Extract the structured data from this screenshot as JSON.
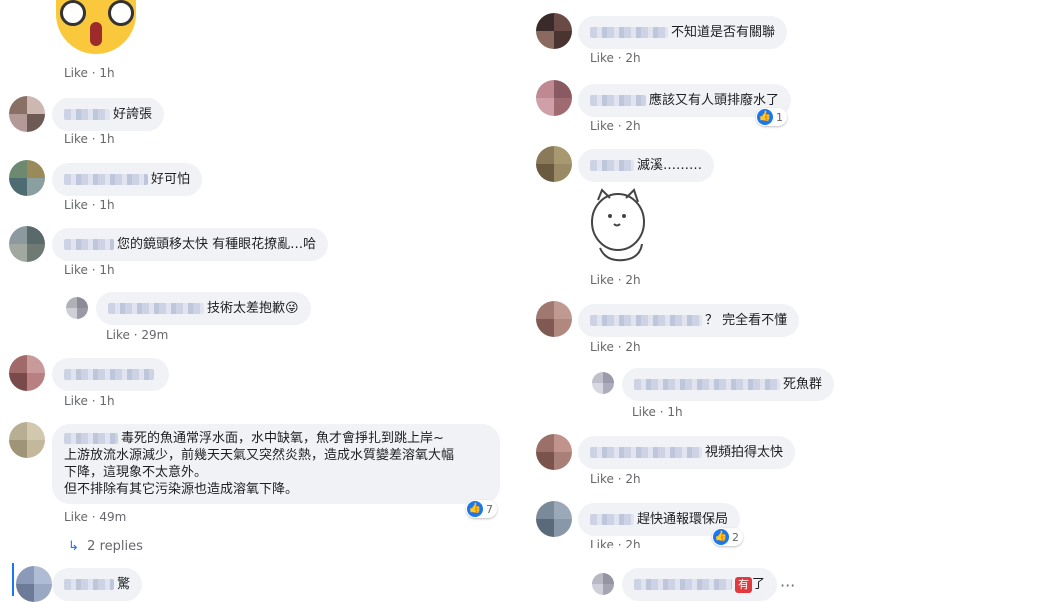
{
  "colors": {
    "bubble": "#f0f2f5",
    "meta": "#65676b",
    "like_blue": "#1877f2",
    "badge_red": "#e0393e"
  },
  "left": {
    "top_sticker": {
      "icon": "shocked-face-sticker",
      "time": "1h",
      "like": "Like"
    },
    "comments": [
      {
        "text": "好誇張",
        "like": "Like",
        "time": "1h"
      },
      {
        "text": "好可怕",
        "like": "Like",
        "time": "1h"
      },
      {
        "text": "您的鏡頭移太快 有種眼花撩亂…哈",
        "like": "Like",
        "time": "1h"
      },
      {
        "text": "技術太差抱歉😜",
        "like": "Like",
        "time": "29m"
      },
      {
        "text": "",
        "like": "Like",
        "time": "1h"
      },
      {
        "line1": "毒死的魚通常浮水面，水中缺氧，魚才會掙扎到跳上岸~",
        "line2": "上游放流水源減少，前幾天天氣又突然炎熱，造成水質變差溶氧大幅",
        "line3": "下降，這現象不太意外。",
        "line4": "但不排除有其它污染源也造成溶氧下降。",
        "like": "Like",
        "time": "49m",
        "reactions": "7"
      },
      {
        "text": "驚"
      }
    ],
    "replies_label": "2 replies",
    "replies_icon": "↳"
  },
  "right": {
    "comments": [
      {
        "text": "不知道是否有關聯",
        "like": "Like",
        "time": "2h"
      },
      {
        "text": "應該又有人頭排廢水了",
        "like": "Like",
        "time": "2h",
        "reactions": "1"
      },
      {
        "text": "滅溪………",
        "like": "Like",
        "time": "2h"
      },
      {
        "text": "？ 完全看不懂",
        "like": "Like",
        "time": "2h"
      },
      {
        "text": "死魚群",
        "like": "Like",
        "time": "1h"
      },
      {
        "text": "視頻拍得太快",
        "like": "Like",
        "time": "2h"
      },
      {
        "text": "趕快通報環保局",
        "like": "Like",
        "time": "2h",
        "reactions": "2"
      },
      {
        "badge": "有",
        "text": "了",
        "more": "···"
      }
    ]
  }
}
